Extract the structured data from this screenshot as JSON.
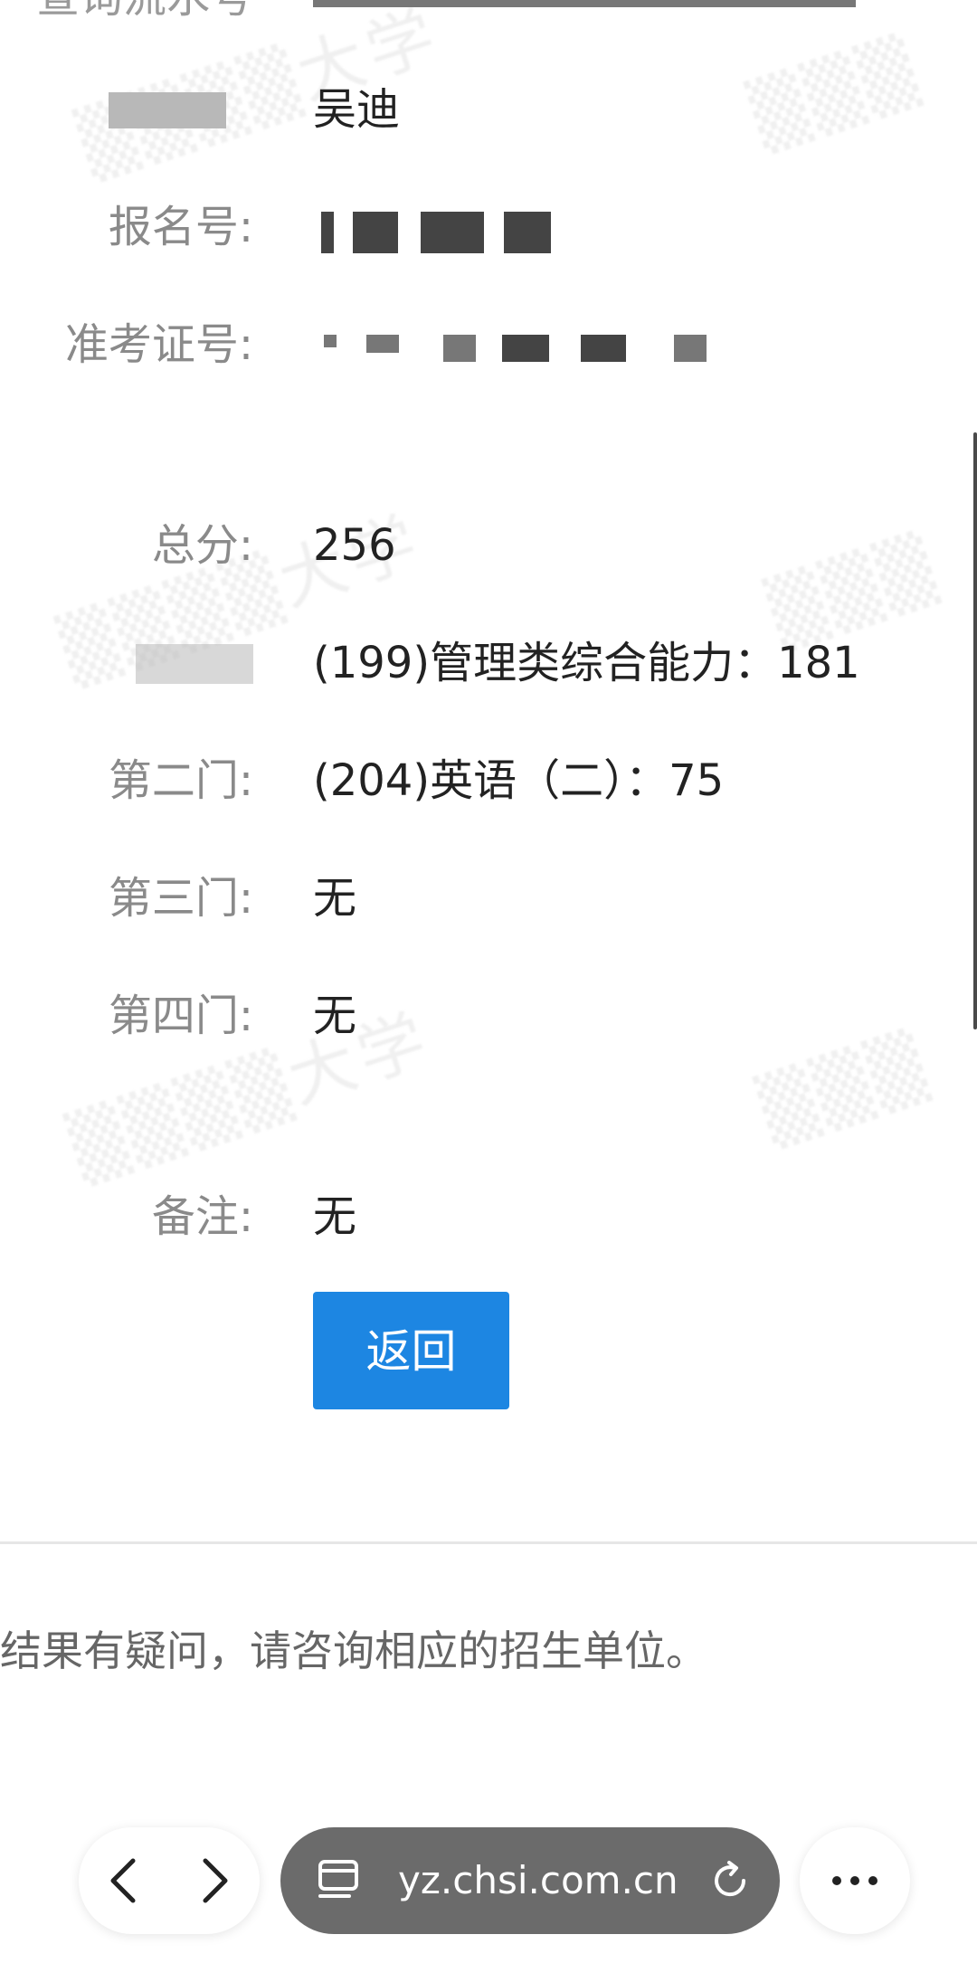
{
  "results": {
    "top_label_partial": "查询流水号",
    "name_value": "吴迪",
    "registration_label": "报名号:",
    "admission_label": "准考证号:",
    "total_label": "总分:",
    "total_value": "256",
    "subject2_label": "第二门:",
    "subject1_value": "(199)管理类综合能力：181",
    "subject2_value": "(204)英语（二）：75",
    "subject3_label": "第三门:",
    "subject3_value": "无",
    "subject4_label": "第四门:",
    "subject4_value": "无",
    "remark_label": "备注:",
    "remark_value": "无"
  },
  "actions": {
    "back_label": "返回"
  },
  "footer": {
    "note": "结果有疑问，请咨询相应的招生单位。"
  },
  "browser": {
    "url": "yz.chsi.com.cn",
    "url_pill_color": "#6b6b6b",
    "accent_button_color": "#1d86e2",
    "icons": [
      "back-arrow-icon",
      "forward-arrow-icon",
      "page-info-icon",
      "reload-icon",
      "more-icon"
    ]
  }
}
